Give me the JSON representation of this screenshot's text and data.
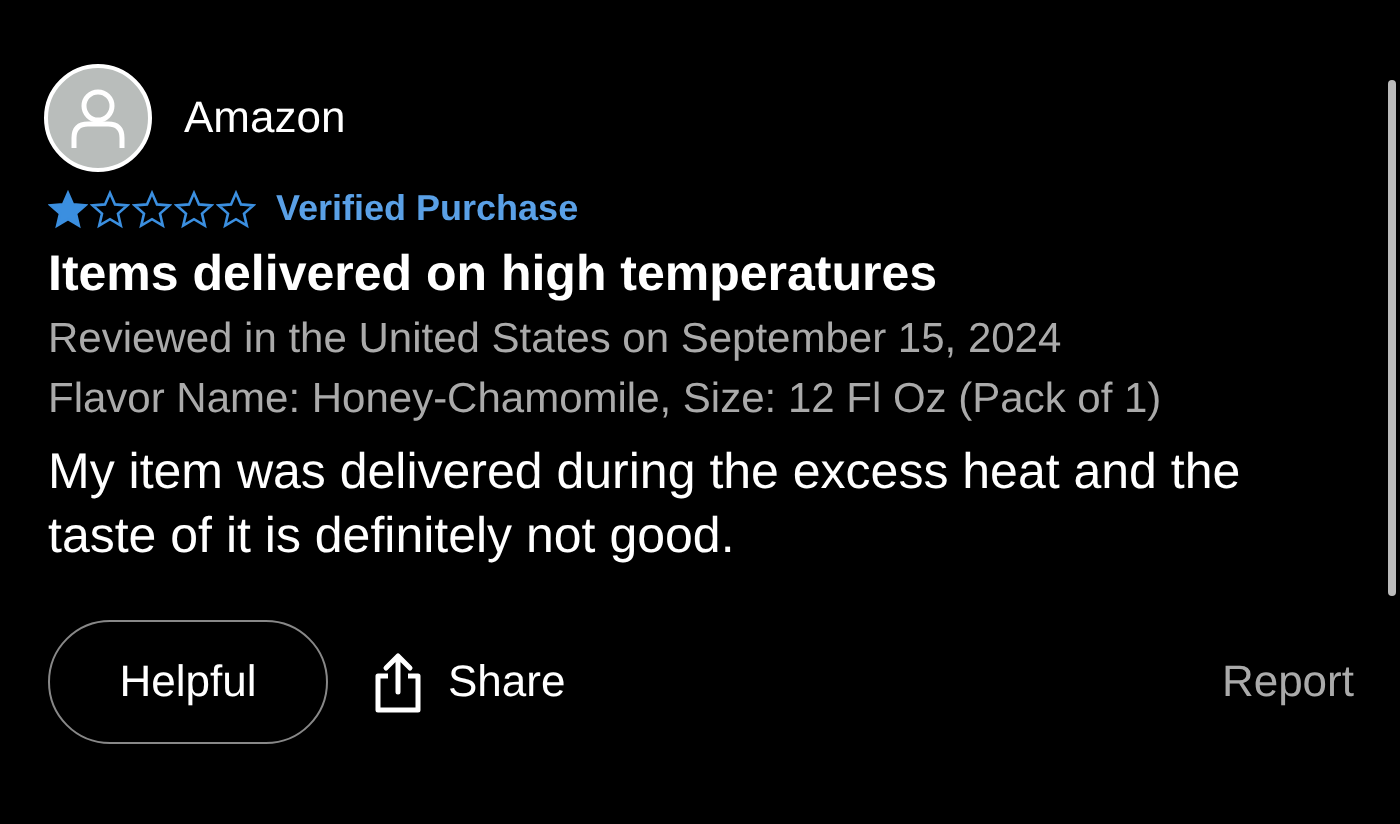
{
  "review": {
    "author": "Amazon",
    "stars": 1,
    "badge": "Verified Purchase",
    "title": "Items delivered on high temperatures",
    "date": "Reviewed in the United States on September 15, 2024",
    "variant": "Flavor Name: Honey-Chamomile, Size: 12 Fl Oz (Pack of 1)",
    "body": "My item was delivered during the excess heat and the taste of it is definitely not good."
  },
  "actions": {
    "helpful": "Helpful",
    "share": "Share",
    "report": "Report"
  }
}
